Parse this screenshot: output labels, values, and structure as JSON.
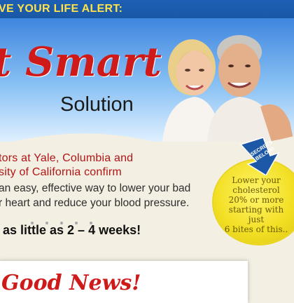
{
  "banner": {
    "text": "VE YOUR LIFE ALERT:"
  },
  "hero": {
    "title": "t Smart",
    "subtitle": "Solution"
  },
  "headline": {
    "line1": "tors at Yale, Columbia and",
    "line2": "sity of California confirm"
  },
  "body": {
    "line1": "an easy, effective way to lower your bad",
    "line2": "r heart and reduce your blood pressure."
  },
  "emphasis": {
    "text": "as little as 2 – 4 weeks!"
  },
  "badge": {
    "line1": "Lower your",
    "line2": "cholesterol",
    "line3": "20% or more",
    "line4": "starting with just",
    "line5": "6 bites of this.."
  },
  "arrow": {
    "line1": "SECRETS",
    "line2": "BELOW!"
  },
  "card": {
    "title": "Good News!"
  },
  "colors": {
    "banner_blue": "#1c5fb4",
    "alert_yellow": "#ffe24a",
    "title_red": "#cf1a1a",
    "badge_yellow": "#f2df23"
  }
}
